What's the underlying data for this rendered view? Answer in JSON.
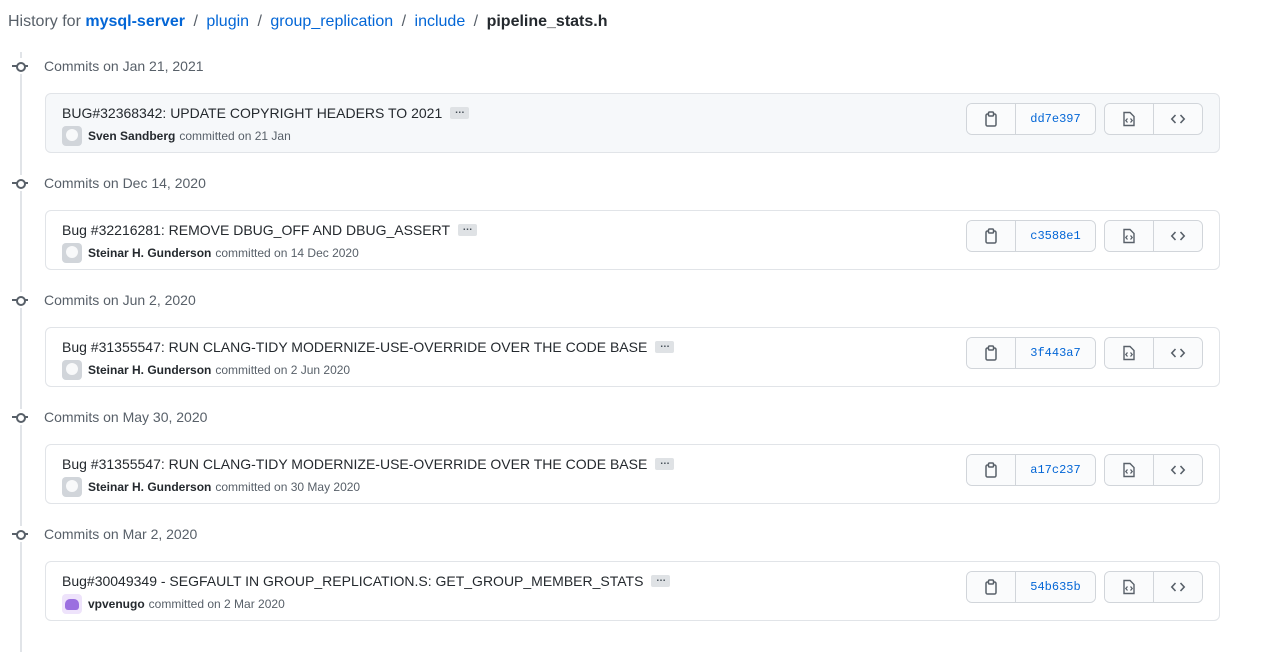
{
  "breadcrumb": {
    "prefix": "History for",
    "repo": "mysql-server",
    "path": [
      "plugin",
      "group_replication",
      "include"
    ],
    "file": "pipeline_stats.h",
    "separator": "/"
  },
  "groups": [
    {
      "title": "Commits on Jan 21, 2021",
      "commit": {
        "message": "BUG#32368342: UPDATE COPYRIGHT HEADERS TO 2021",
        "ellipsis": "…",
        "author": "Sven Sandberg",
        "committed_text": "committed on 21 Jan",
        "sha": "dd7e397",
        "avatar": "default-avatar"
      }
    },
    {
      "title": "Commits on Dec 14, 2020",
      "commit": {
        "message": "Bug #32216281: REMOVE DBUG_OFF AND DBUG_ASSERT",
        "ellipsis": "…",
        "author": "Steinar H. Gunderson",
        "committed_text": "committed on 14 Dec 2020",
        "sha": "c3588e1",
        "avatar": "default-avatar"
      }
    },
    {
      "title": "Commits on Jun 2, 2020",
      "commit": {
        "message": "Bug #31355547: RUN CLANG-TIDY MODERNIZE-USE-OVERRIDE OVER THE CODE BASE",
        "ellipsis": "…",
        "author": "Steinar H. Gunderson",
        "committed_text": "committed on 2 Jun 2020",
        "sha": "3f443a7",
        "avatar": "default-avatar"
      }
    },
    {
      "title": "Commits on May 30, 2020",
      "commit": {
        "message": "Bug #31355547: RUN CLANG-TIDY MODERNIZE-USE-OVERRIDE OVER THE CODE BASE",
        "ellipsis": "…",
        "author": "Steinar H. Gunderson",
        "committed_text": "committed on 30 May 2020",
        "sha": "a17c237",
        "avatar": "default-avatar"
      }
    },
    {
      "title": "Commits on Mar 2, 2020",
      "commit": {
        "message": "Bug#30049349 - SEGFAULT IN GROUP_REPLICATION.S: GET_GROUP_MEMBER_STATS",
        "ellipsis": "…",
        "author": "vpvenugo",
        "committed_text": "committed on 2 Mar 2020",
        "sha": "54b635b",
        "avatar": "purple-avatar"
      }
    }
  ],
  "icons": {
    "copy": "clipboard-icon",
    "browse_file": "file-code-icon",
    "browse_tree": "code-icon",
    "timeline": "git-commit-icon"
  },
  "colors": {
    "link": "#0366d6",
    "muted": "#586069",
    "border": "#e1e4e8"
  }
}
